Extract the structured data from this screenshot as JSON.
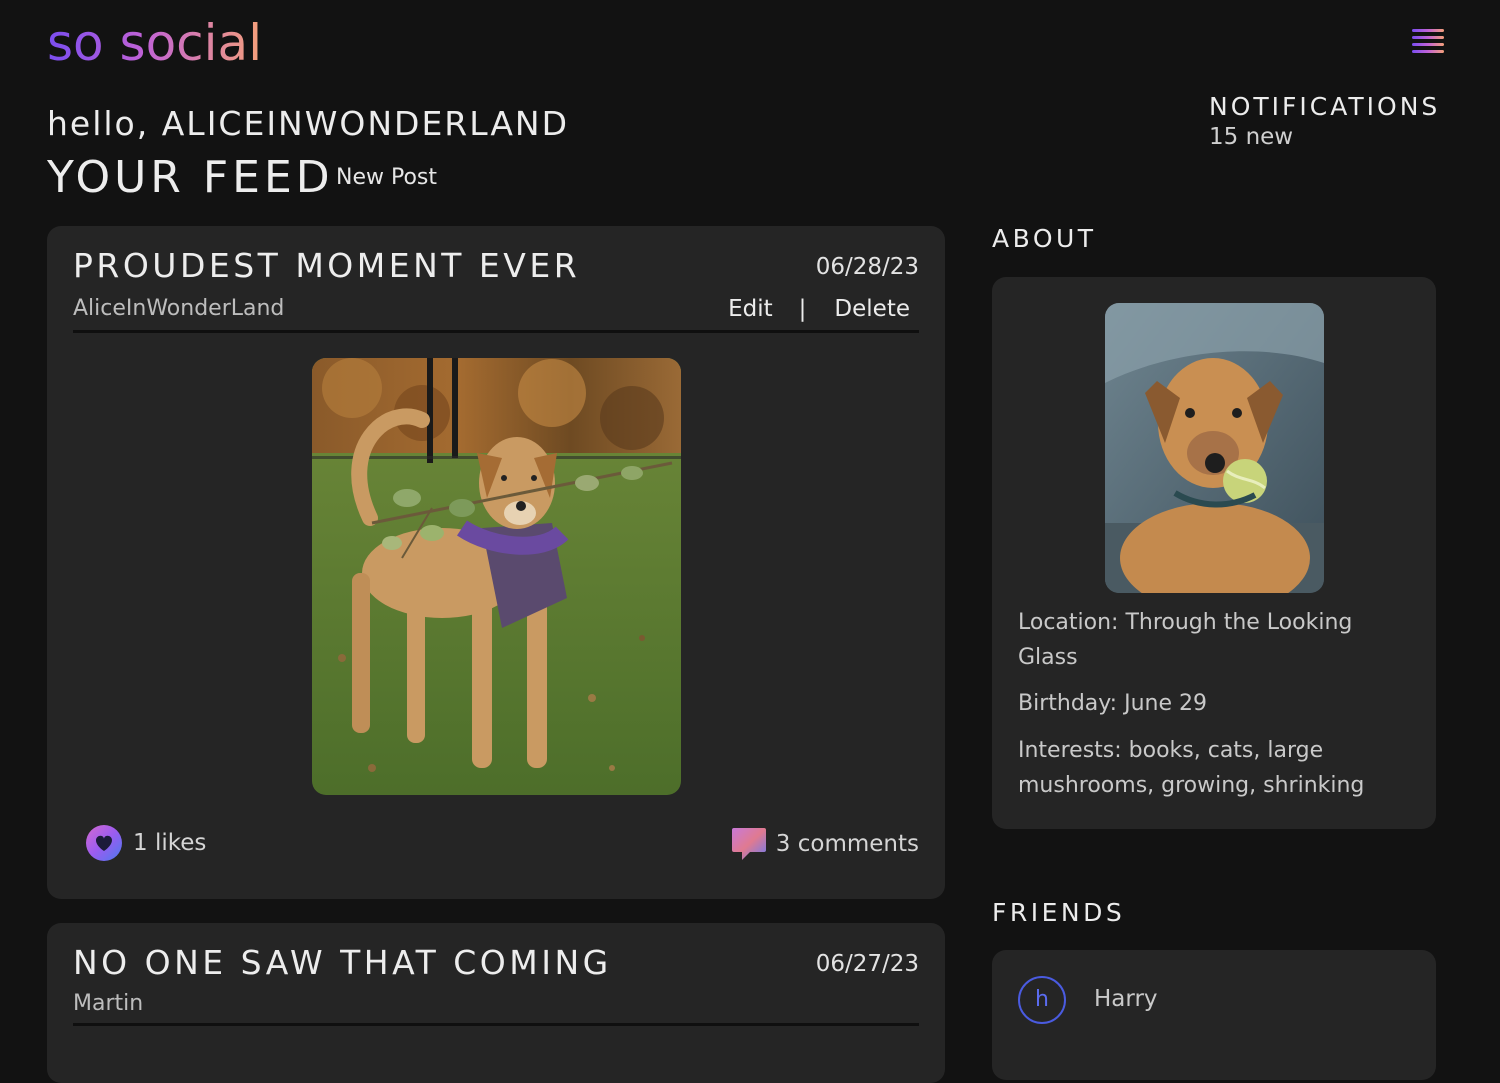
{
  "app": {
    "logo": "so social"
  },
  "header": {
    "greeting_prefix": "hello,",
    "username": "ALICEINWONDERLAND",
    "feed_title": "YOUR FEED",
    "new_post_label": "New Post",
    "notifications_label": "NOTIFICATIONS",
    "notifications_count": "15 new"
  },
  "posts": [
    {
      "title": "PROUDEST MOMENT EVER",
      "date": "06/28/23",
      "author": "AliceInWonderLand",
      "edit_label": "Edit",
      "separator": "|",
      "delete_label": "Delete",
      "likes_text": "1 likes",
      "comments_text": "3 comments"
    },
    {
      "title": "NO ONE SAW THAT COMING",
      "date": "06/27/23",
      "author": "Martin"
    }
  ],
  "about": {
    "label": "ABOUT",
    "location": "Location: Through the Looking Glass",
    "birthday": "Birthday: June 29",
    "interests": "Interests: books, cats, large mushrooms, growing, shrinking"
  },
  "friends": {
    "label": "FRIENDS",
    "items": [
      {
        "initial": "h",
        "name": "Harry"
      }
    ]
  },
  "colors": {
    "background": "#121212",
    "card": "#252525",
    "accent_purple": "#7a4df0",
    "accent_pink": "#c062d6",
    "accent_peach": "#f5a07a",
    "friend_ring": "#4a5be0"
  },
  "icons": [
    "menu-icon",
    "heart-icon",
    "comment-icon"
  ]
}
